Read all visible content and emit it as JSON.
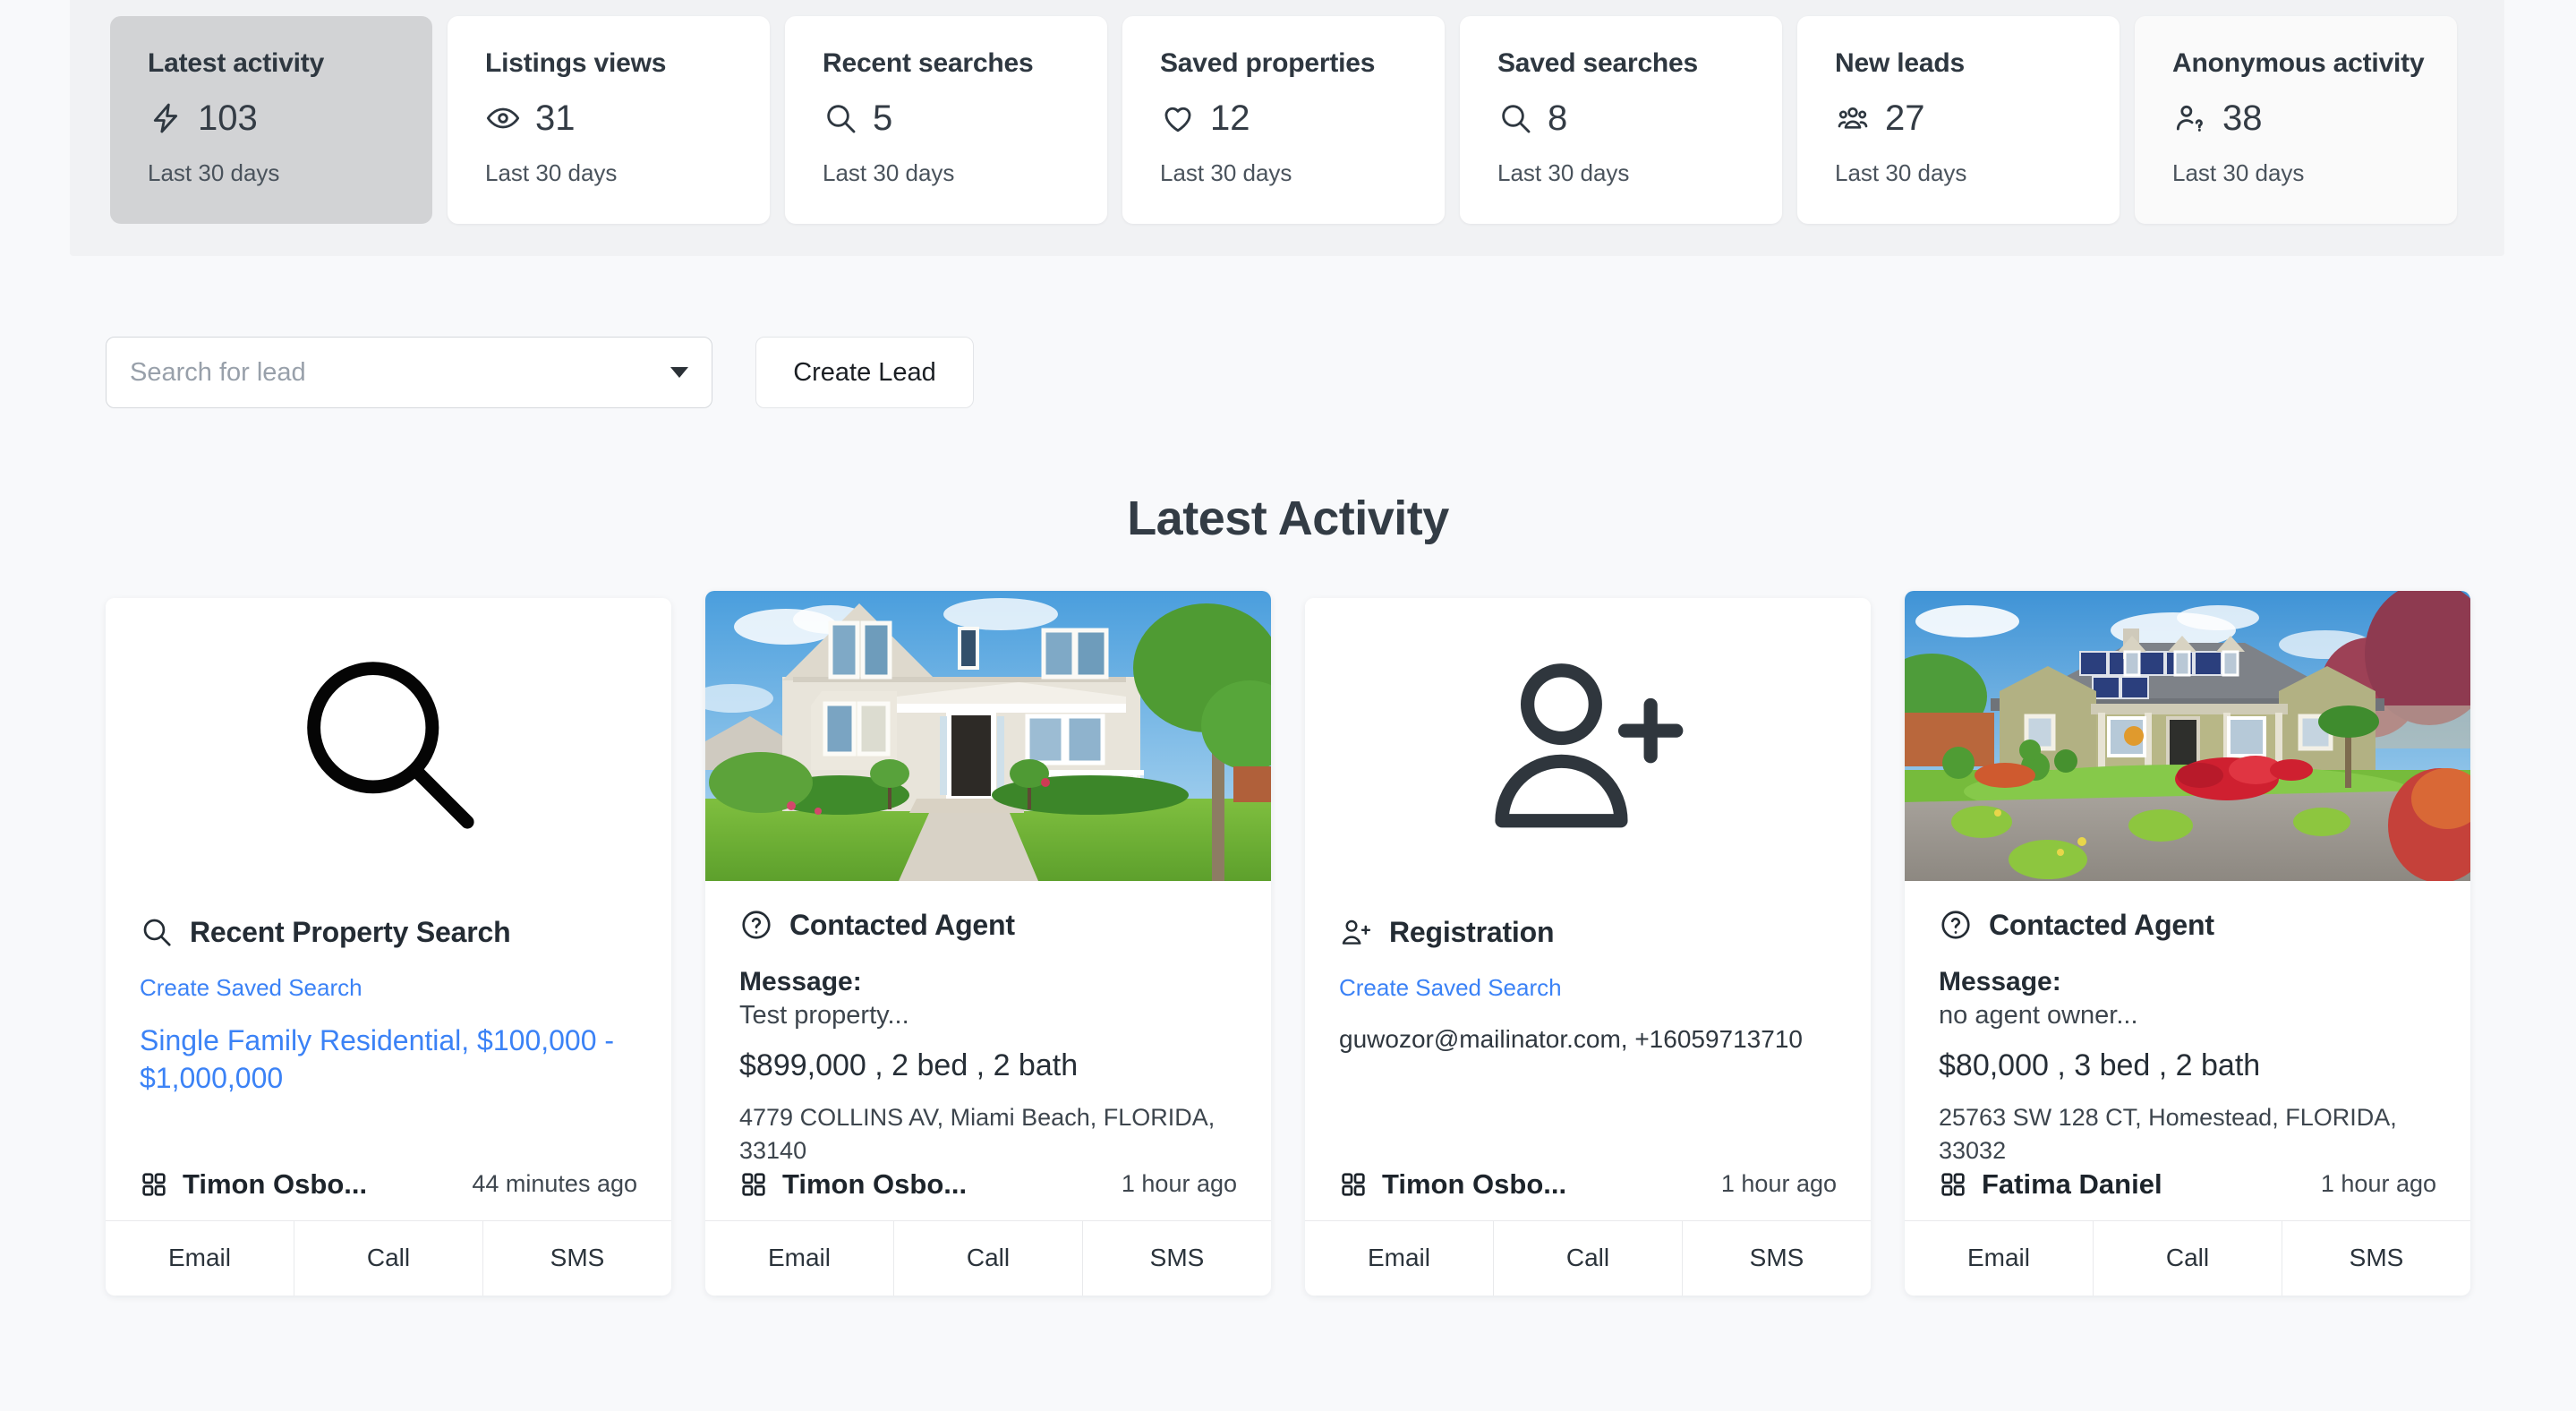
{
  "stats": {
    "cards": [
      {
        "title": "Latest activity",
        "icon": "bolt-icon",
        "value": "103",
        "period": "Last 30 days",
        "state": "active"
      },
      {
        "title": "Listings views",
        "icon": "eye-icon",
        "value": "31",
        "period": "Last 30 days",
        "state": "default"
      },
      {
        "title": "Recent searches",
        "icon": "search-icon",
        "value": "5",
        "period": "Last 30 days",
        "state": "default"
      },
      {
        "title": "Saved properties",
        "icon": "heart-icon",
        "value": "12",
        "period": "Last 30 days",
        "state": "default"
      },
      {
        "title": "Saved searches",
        "icon": "search-icon",
        "value": "8",
        "period": "Last 30 days",
        "state": "default"
      },
      {
        "title": "New leads",
        "icon": "users-group-icon",
        "value": "27",
        "period": "Last 30 days",
        "state": "default"
      },
      {
        "title": "Anonymous activity",
        "icon": "user-question-icon",
        "value": "38",
        "period": "Last 30 days",
        "state": "muted"
      }
    ]
  },
  "toolbar": {
    "lead_search_placeholder": "Search for lead",
    "lead_search_value": "",
    "create_lead_label": "Create Lead"
  },
  "section": {
    "heading": "Latest Activity"
  },
  "activity": {
    "action_labels": {
      "email": "Email",
      "call": "Call",
      "sms": "SMS"
    },
    "cards": [
      {
        "media": "search-icon-placeholder",
        "head_icon": "search-icon",
        "head_title": "Recent Property Search",
        "saved_search_link": "Create Saved Search",
        "search_criteria": "Single Family Residential, $100,000 - $1,000,000",
        "lead_name": "Timon Osbo...",
        "time_ago": "44 minutes ago"
      },
      {
        "media": "property-photo-two-story-house",
        "head_icon": "question-circle-icon",
        "head_title": "Contacted Agent",
        "message_label": "Message:",
        "message_text": "Test property...",
        "price_line": "$899,000 , 2 bed , 2 bath",
        "address": "4779 COLLINS AV, Miami Beach, FLORIDA, 33140",
        "lead_name": "Timon Osbo...",
        "time_ago": "1 hour ago"
      },
      {
        "media": "user-plus-icon-placeholder",
        "head_icon": "user-plus-icon",
        "head_title": "Registration",
        "saved_search_link": "Create Saved Search",
        "contact": "guwozor@mailinator.com, +16059713710",
        "lead_name": "Timon Osbo...",
        "time_ago": "1 hour ago"
      },
      {
        "media": "property-photo-ranch-house",
        "head_icon": "question-circle-icon",
        "head_title": "Contacted Agent",
        "message_label": "Message:",
        "message_text": "no agent owner...",
        "price_line": "$80,000 , 3 bed , 2 bath",
        "address": "25763 SW 128 CT, Homestead, FLORIDA, 33032",
        "lead_name": "Fatima Daniel",
        "time_ago": "1 hour ago"
      }
    ]
  },
  "colors": {
    "page_bg": "#f8f9fb",
    "band_bg": "#f1f2f4",
    "card_bg": "#ffffff",
    "active_card_bg": "#d2d3d5",
    "link_blue": "#3b82f6",
    "text_dark": "#2e3740"
  }
}
